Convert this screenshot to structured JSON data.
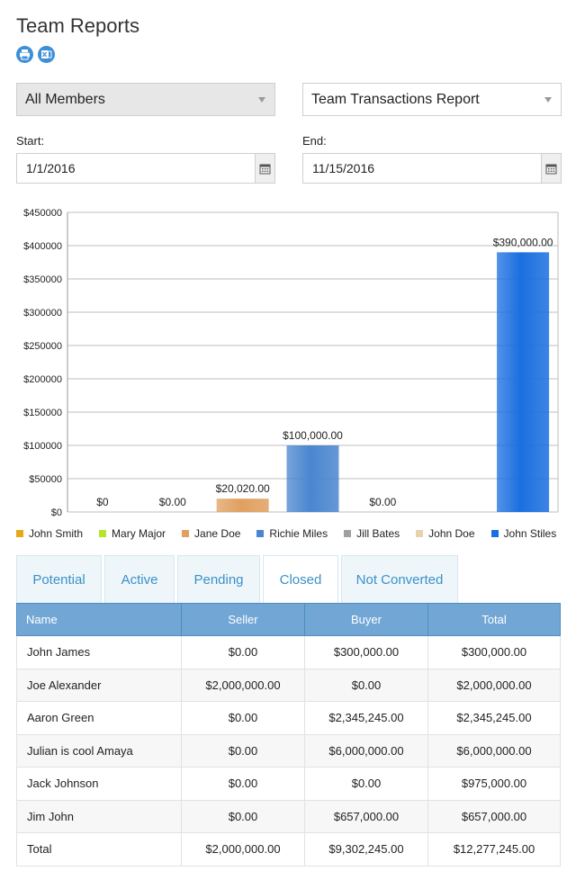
{
  "header": {
    "title": "Team Reports"
  },
  "toolbar": {
    "print_icon": "printer-icon",
    "excel_icon": "excel-export-icon"
  },
  "filters": {
    "members": "All Members",
    "report": "Team Transactions Report",
    "start_label": "Start:",
    "start_value": "1/1/2016",
    "end_label": "End:",
    "end_value": "11/15/2016"
  },
  "chart_data": {
    "type": "bar",
    "categories": [
      "John Smith",
      "Mary Major",
      "Jane Doe",
      "Richie Miles",
      "Jill Bates",
      "John Doe",
      "John Stiles"
    ],
    "values": [
      0,
      0,
      20020,
      100000,
      0,
      0,
      390000
    ],
    "data_labels": [
      "$0",
      "$0.00",
      "$20,020.00",
      "$100,000.00",
      "$0.00",
      "",
      "$390,000.00"
    ],
    "colors": [
      "#e8a81c",
      "#b4e62c",
      "#e0a060",
      "#4a86cf",
      "#a0a0a0",
      "#e6d2ad",
      "#1a6fe0"
    ],
    "ylim": [
      0,
      450000
    ],
    "yticks": [
      "$0",
      "$50000",
      "$100000",
      "$150000",
      "$200000",
      "$250000",
      "$300000",
      "$350000",
      "$400000",
      "$450000"
    ],
    "legend_position": "bottom",
    "grid": true
  },
  "tabs": [
    {
      "label": "Potential",
      "active": false
    },
    {
      "label": "Active",
      "active": false
    },
    {
      "label": "Pending",
      "active": false
    },
    {
      "label": "Closed",
      "active": true
    },
    {
      "label": "Not Converted",
      "active": false
    }
  ],
  "table": {
    "headers": [
      "Name",
      "Seller",
      "Buyer",
      "Total"
    ],
    "rows": [
      [
        "John James",
        "$0.00",
        "$300,000.00",
        "$300,000.00"
      ],
      [
        "Joe Alexander",
        "$2,000,000.00",
        "$0.00",
        "$2,000,000.00"
      ],
      [
        "Aaron Green",
        "$0.00",
        "$2,345,245.00",
        "$2,345,245.00"
      ],
      [
        "Julian is cool Amaya",
        "$0.00",
        "$6,000,000.00",
        "$6,000,000.00"
      ],
      [
        "Jack Johnson",
        "$0.00",
        "$0.00",
        "$975,000.00"
      ],
      [
        "Jim John",
        "$0.00",
        "$657,000.00",
        "$657,000.00"
      ],
      [
        "Total",
        "$2,000,000.00",
        "$9,302,245.00",
        "$12,277,245.00"
      ]
    ]
  }
}
